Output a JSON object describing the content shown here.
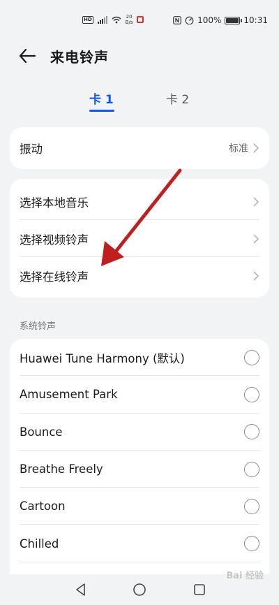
{
  "status_bar": {
    "hd_label": "HD",
    "net_speed_value": "20",
    "net_speed_unit": "B/s",
    "battery_percent": "100%",
    "time": "10:31",
    "icons": [
      "hd-icon",
      "signal-icon",
      "wifi-icon",
      "notification-icon",
      "nfc-icon",
      "speed-icon",
      "battery-icon"
    ]
  },
  "header": {
    "title": "来电铃声",
    "back_icon": "arrow-left-icon"
  },
  "tabs": [
    {
      "label": "卡 1",
      "active": true
    },
    {
      "label": "卡 2",
      "active": false
    }
  ],
  "vibration": {
    "label": "振动",
    "value": "标准"
  },
  "choose_options": [
    {
      "label": "选择本地音乐"
    },
    {
      "label": "选择视频铃声"
    },
    {
      "label": "选择在线铃声"
    }
  ],
  "system_ringtones": {
    "section_label": "系统铃声",
    "items": [
      {
        "label": "Huawei Tune Harmony (默认)",
        "selected": false
      },
      {
        "label": "Amusement Park",
        "selected": false
      },
      {
        "label": "Bounce",
        "selected": false
      },
      {
        "label": "Breathe Freely",
        "selected": false
      },
      {
        "label": "Cartoon",
        "selected": false
      },
      {
        "label": "Chilled",
        "selected": false
      }
    ]
  },
  "watermark": "Bai 经验",
  "colors": {
    "accent": "#0a59f7",
    "background": "#f1f3f5",
    "annotation_arrow": "#c0201d"
  }
}
